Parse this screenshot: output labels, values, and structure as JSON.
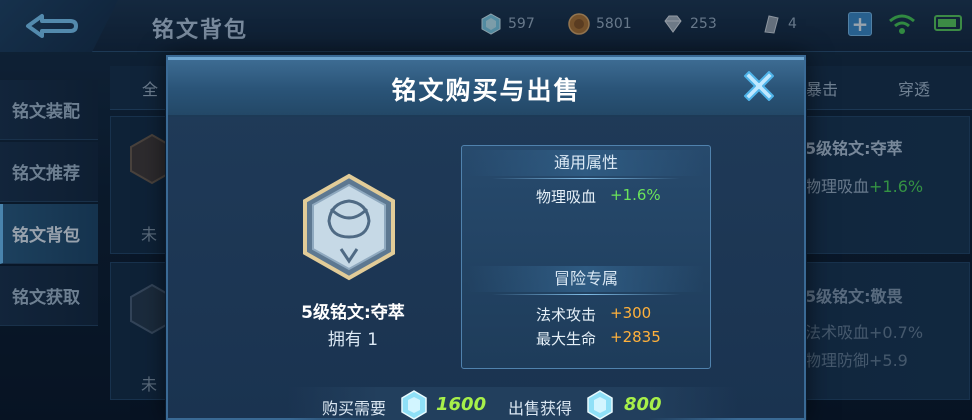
{
  "header": {
    "title": "铭文背包",
    "resources": [
      {
        "icon": "diamond-icon",
        "value": "597"
      },
      {
        "icon": "gold-coin-icon",
        "value": "5801"
      },
      {
        "icon": "crystal-gem-icon",
        "value": "253"
      },
      {
        "icon": "fragment-icon",
        "value": "4"
      }
    ]
  },
  "sidebar": {
    "items": [
      {
        "label": "铭文装配"
      },
      {
        "label": "铭文推荐"
      },
      {
        "label": "铭文背包"
      },
      {
        "label": "铭文获取"
      }
    ],
    "active_index": 2
  },
  "background": {
    "filter_tabs": [
      "全",
      "暴击",
      "穿透"
    ],
    "card1": {
      "name": "5级铭文:夺萃",
      "stat_label": "物理吸血",
      "stat_value": "+1.6%",
      "status": "未"
    },
    "card2": {
      "name": "5级铭文:敬畏",
      "stat1": "法术吸血+0.7%",
      "stat2": "物理防御+5.9",
      "status": "未"
    }
  },
  "modal": {
    "title": "铭文购买与出售",
    "item": {
      "name": "5级铭文:夺萃",
      "owned_text": "拥有 1"
    },
    "general": {
      "heading": "通用属性",
      "stats": [
        {
          "name": "物理吸血",
          "value": "+1.6%"
        }
      ]
    },
    "adventure": {
      "heading": "冒险专属",
      "stats": [
        {
          "name": "法术攻击",
          "value": "+300"
        },
        {
          "name": "最大生命",
          "value": "+2835"
        }
      ]
    },
    "buy": {
      "label": "购买需要",
      "value": "1600",
      "icon": "diamond-icon"
    },
    "sell": {
      "label": "出售获得",
      "value": "800",
      "icon": "diamond-icon"
    }
  },
  "colors": {
    "accent_green": "#6be35a",
    "accent_orange": "#ffb13c",
    "price_green": "#a7f04a",
    "modal_border": "#3a6a95"
  }
}
